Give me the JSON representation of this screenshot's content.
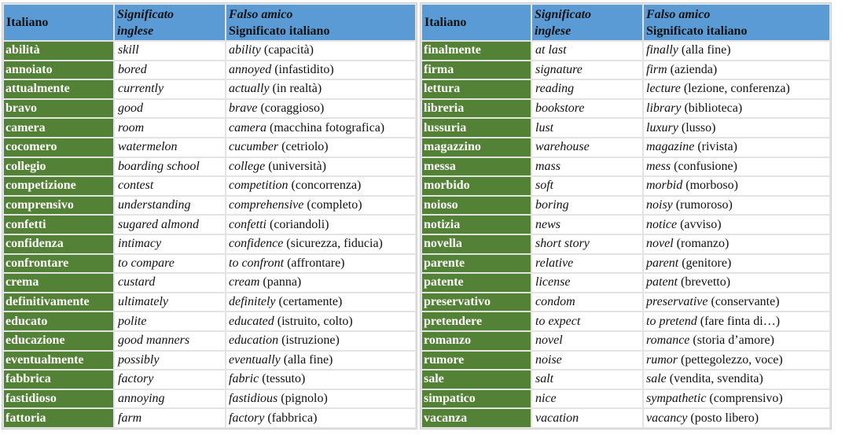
{
  "headers": {
    "italiano": "Italiano",
    "significato_inglese_line1": "Significato",
    "significato_inglese_line2": "inglese",
    "falso_amico_line1": "Falso amico",
    "falso_amico_line2": "Significato italiano"
  },
  "colors": {
    "header_bg": "#5b9bd5",
    "italian_cell_bg": "#538135",
    "italian_cell_text": "#ffffff",
    "grid": "#e3e3e3"
  },
  "left_table": {
    "rows": [
      {
        "italiano": "abilità",
        "inglese": "skill",
        "falso_amico": "ability",
        "significato_italiano": "(capacità)"
      },
      {
        "italiano": "annoiato",
        "inglese": "bored",
        "falso_amico": "annoyed",
        "significato_italiano": "(infastidito)"
      },
      {
        "italiano": "attualmente",
        "inglese": "currently",
        "falso_amico": "actually",
        "significato_italiano": "(in realtà)"
      },
      {
        "italiano": "bravo",
        "inglese": "good",
        "falso_amico": "brave",
        "significato_italiano": "(coraggioso)"
      },
      {
        "italiano": "camera",
        "inglese": "room",
        "falso_amico": "camera",
        "significato_italiano": "(macchina fotografica)"
      },
      {
        "italiano": "cocomero",
        "inglese": "watermelon",
        "falso_amico": "cucumber",
        "significato_italiano": "(cetriolo)"
      },
      {
        "italiano": "collegio",
        "inglese": "boarding school",
        "falso_amico": "college",
        "significato_italiano": "(università)"
      },
      {
        "italiano": "competizione",
        "inglese": "contest",
        "falso_amico": "competition",
        "significato_italiano": "(concorrenza)"
      },
      {
        "italiano": "comprensivo",
        "inglese": "understanding",
        "falso_amico": "comprehensive",
        "significato_italiano": "(completo)"
      },
      {
        "italiano": "confetti",
        "inglese": "sugared almond",
        "falso_amico": "confetti",
        "significato_italiano": "(coriandoli)"
      },
      {
        "italiano": "confidenza",
        "inglese": "intimacy",
        "falso_amico": "confidence",
        "significato_italiano": "(sicurezza, fiducia)"
      },
      {
        "italiano": "confrontare",
        "inglese": "to compare",
        "falso_amico": "to confront",
        "significato_italiano": "(affrontare)"
      },
      {
        "italiano": "crema",
        "inglese": "custard",
        "falso_amico": "cream",
        "significato_italiano": "(panna)"
      },
      {
        "italiano": "definitivamente",
        "inglese": "ultimately",
        "falso_amico": "definitely",
        "significato_italiano": "(certamente)"
      },
      {
        "italiano": "educato",
        "inglese": "polite",
        "falso_amico": "educated",
        "significato_italiano": "(istruito, colto)"
      },
      {
        "italiano": "educazione",
        "inglese": "good manners",
        "falso_amico": "education",
        "significato_italiano": "(istruzione)"
      },
      {
        "italiano": "eventualmente",
        "inglese": "possibly",
        "falso_amico": "eventually",
        "significato_italiano": "(alla fine)"
      },
      {
        "italiano": "fabbrica",
        "inglese": "factory",
        "falso_amico": "fabric",
        "significato_italiano": "(tessuto)"
      },
      {
        "italiano": "fastidioso",
        "inglese": "annoying",
        "falso_amico": "fastidious",
        "significato_italiano": "(pignolo)"
      },
      {
        "italiano": "fattoria",
        "inglese": "farm",
        "falso_amico": "factory",
        "significato_italiano": "(fabbrica)"
      }
    ]
  },
  "right_table": {
    "rows": [
      {
        "italiano": "finalmente",
        "inglese": "at last",
        "falso_amico": "finally",
        "significato_italiano": "(alla fine)"
      },
      {
        "italiano": "firma",
        "inglese": "signature",
        "falso_amico": "firm",
        "significato_italiano": "(azienda)"
      },
      {
        "italiano": "lettura",
        "inglese": "reading",
        "falso_amico": "lecture",
        "significato_italiano": "(lezione, conferenza)"
      },
      {
        "italiano": "libreria",
        "inglese": "bookstore",
        "falso_amico": "library",
        "significato_italiano": "(biblioteca)"
      },
      {
        "italiano": "lussuria",
        "inglese": "lust",
        "falso_amico": "luxury",
        "significato_italiano": "(lusso)"
      },
      {
        "italiano": "magazzino",
        "inglese": "warehouse",
        "falso_amico": "magazine",
        "significato_italiano": "(rivista)"
      },
      {
        "italiano": "messa",
        "inglese": "mass",
        "falso_amico": "mess",
        "significato_italiano": "(confusione)"
      },
      {
        "italiano": "morbido",
        "inglese": "soft",
        "falso_amico": "morbid",
        "significato_italiano": "(morboso)"
      },
      {
        "italiano": "noioso",
        "inglese": "boring",
        "falso_amico": "noisy",
        "significato_italiano": "(rumoroso)"
      },
      {
        "italiano": "notizia",
        "inglese": "news",
        "falso_amico": "notice",
        "significato_italiano": "(avviso)"
      },
      {
        "italiano": "novella",
        "inglese": "short story",
        "falso_amico": "novel",
        "significato_italiano": "(romanzo)"
      },
      {
        "italiano": "parente",
        "inglese": "relative",
        "falso_amico": "parent",
        "significato_italiano": "(genitore)"
      },
      {
        "italiano": "patente",
        "inglese": "license",
        "falso_amico": "patent",
        "significato_italiano": "(brevetto)"
      },
      {
        "italiano": "preservativo",
        "inglese": "condom",
        "falso_amico": "preservative",
        "significato_italiano": "(conservante)"
      },
      {
        "italiano": "pretendere",
        "inglese": "to expect",
        "falso_amico": "to pretend",
        "significato_italiano": "(fare finta di…)"
      },
      {
        "italiano": "romanzo",
        "inglese": "novel",
        "falso_amico": "romance",
        "significato_italiano": "(storia d’amore)"
      },
      {
        "italiano": "rumore",
        "inglese": "noise",
        "falso_amico": "rumor",
        "significato_italiano": "(pettegolezzo, voce)"
      },
      {
        "italiano": "sale",
        "inglese": "salt",
        "falso_amico": "sale",
        "significato_italiano": "(vendita, svendita)"
      },
      {
        "italiano": "simpatico",
        "inglese": "nice",
        "falso_amico": "sympathetic",
        "significato_italiano": "(comprensivo)"
      },
      {
        "italiano": "vacanza",
        "inglese": "vacation",
        "falso_amico": "vacancy",
        "significato_italiano": "(posto libero)"
      }
    ]
  }
}
